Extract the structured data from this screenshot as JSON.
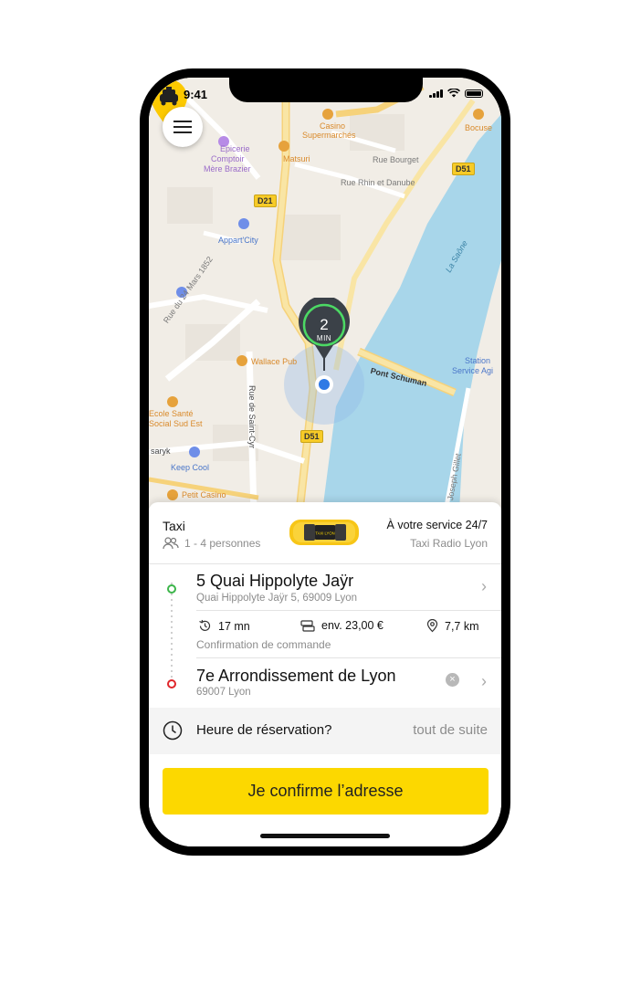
{
  "status_bar": {
    "time": "9:41"
  },
  "map": {
    "labels": {
      "casino": "Casino",
      "supermarches": "Supermarchés",
      "epicerie": "Epicerie",
      "comptoir": "Comptoir",
      "mere_brazier": "Mère Brazier",
      "matsuri": "Matsuri",
      "rue_bourget": "Rue Bourget",
      "rue_rhin": "Rue Rhin et Danube",
      "bocuse": "Bocuse",
      "appart_city": "Appart'City",
      "rue_24_mars": "Rue du 24 Mars 1852",
      "la_saone": "La Saône",
      "station": "Station",
      "service_agi": "Service Agi",
      "wallace_pub": "Wallace Pub",
      "pont_schuman": "Pont Schuman",
      "rue_saint_cyr": "Rue de Saint-Cyr",
      "ecole_sante": "Ecole Santé",
      "social_sud_est": "Social Sud Est",
      "saryk": "saryk",
      "keep_cool": "Keep Cool",
      "petit_casino": "Petit Casino",
      "joseph_gillet": "Joseph Gillet"
    },
    "road_badges": {
      "d51_top": "D51",
      "d21": "D21",
      "d51_bottom": "D51"
    },
    "eta": {
      "value": "2",
      "unit": "MIN"
    }
  },
  "booking": {
    "vehicle_type": "Taxi",
    "capacity": "1 - 4 personnes",
    "service_hours": "À votre service 24/7",
    "company": "Taxi Radio Lyon",
    "car_badge": "TAXI LYON",
    "pickup": {
      "title": "5 Quai Hippolyte Jaÿr",
      "subtitle": "Quai Hippolyte Jaÿr 5, 69009 Lyon"
    },
    "trip_info": {
      "duration": "17 mn",
      "price": "env. 23,00 €",
      "distance": "7,7 km",
      "status": "Confirmation de commande"
    },
    "destination": {
      "title": "7e Arrondissement de Lyon",
      "subtitle": "69007 Lyon"
    },
    "reservation": {
      "label": "Heure de réservation?",
      "value": "tout de suite"
    },
    "confirm_button": "Je confirme l’adresse"
  },
  "colors": {
    "accent": "#fcd800",
    "pickup_dot": "#3cb54a",
    "destination_dot": "#e0262b",
    "water": "#a8d6ea",
    "eta_ring": "#4cd964"
  }
}
